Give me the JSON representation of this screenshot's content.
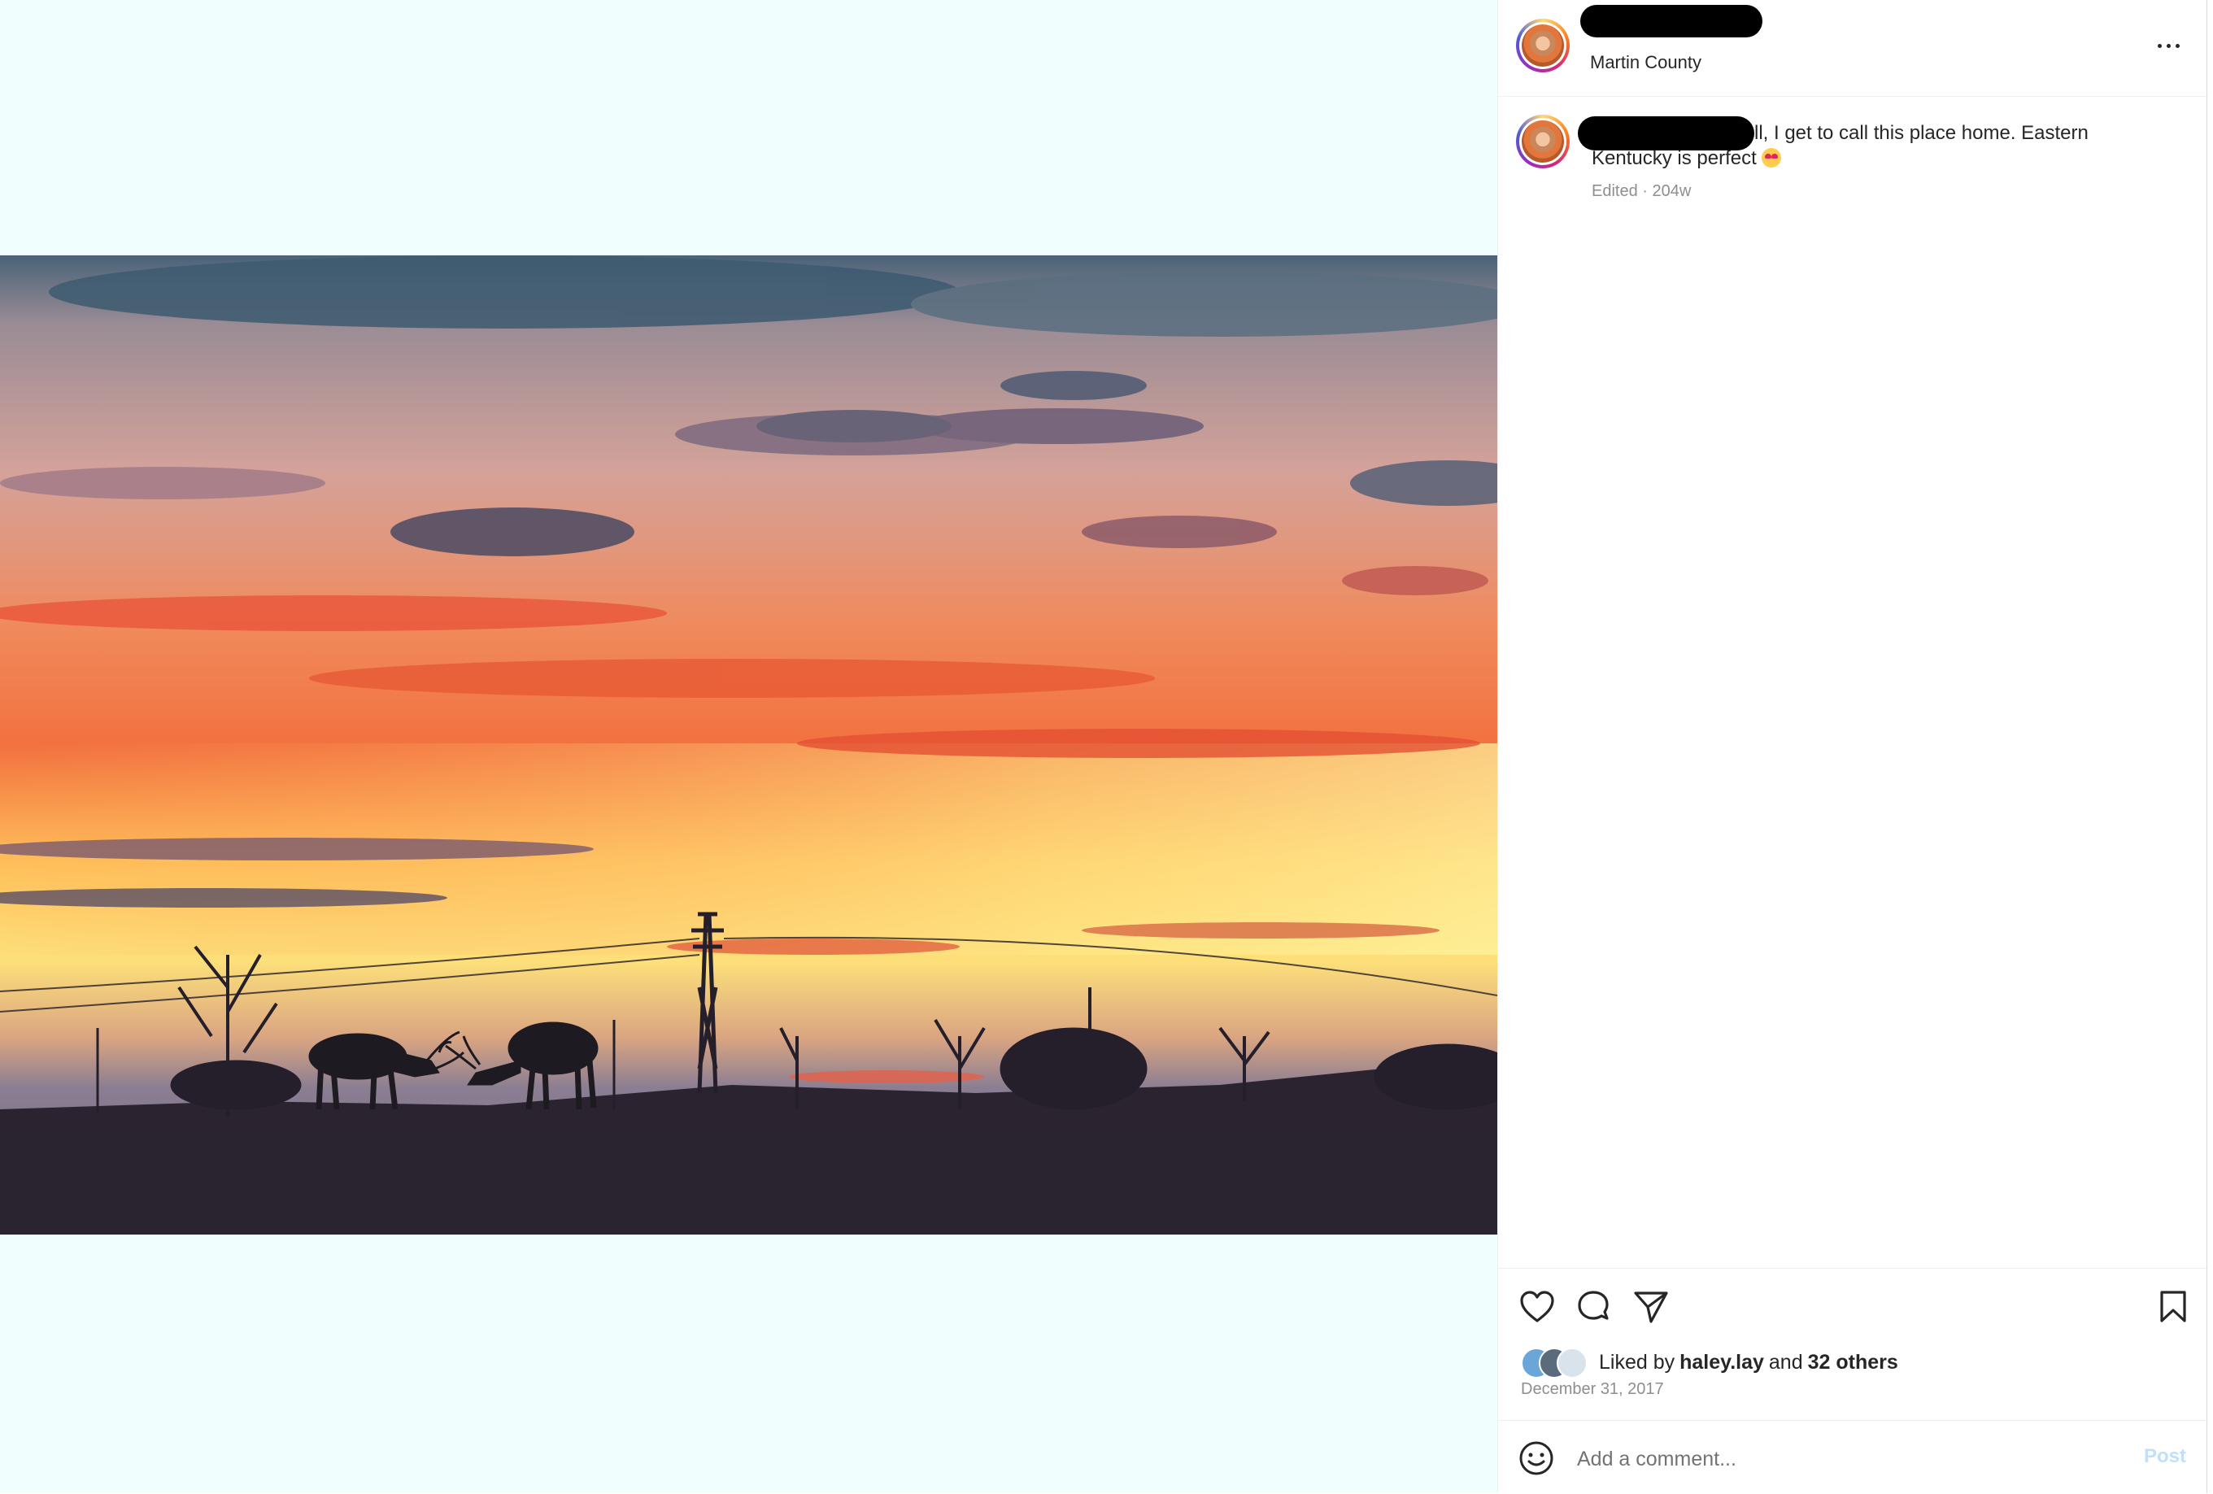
{
  "post": {
    "location": "Martin County",
    "caption": "ll, I get to call this place home. Eastern Kentucky is perfect",
    "meta": "Edited · 204w",
    "liked_prefix": "Liked by",
    "liked_user": "haley.lay",
    "liked_and": "and",
    "liked_others": "32 others",
    "date": "December 31, 2017"
  },
  "comment": {
    "placeholder": "Add a comment...",
    "post_label": "Post"
  },
  "icons": {
    "like": "heart-icon",
    "comment": "comment-bubble-icon",
    "share": "paper-plane-icon",
    "save": "bookmark-icon",
    "emoji": "smiley-icon",
    "more": "more-horizontal-icon"
  },
  "colors": {
    "media_background": "#f0fffe",
    "muted_text": "#8e8e8e",
    "post_button_disabled": "#c0dffd"
  }
}
